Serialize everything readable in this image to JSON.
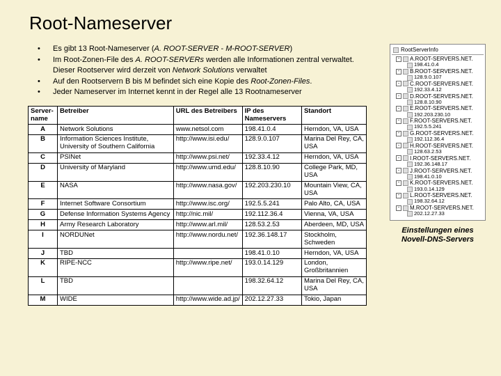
{
  "title": "Root-Nameserver",
  "bullets": [
    "Es gibt 13 Root-Nameserver  (<em>A. ROOT-SERVER</em> - <em>M-ROOT-SERVER</em>)",
    "Im Root-Zonen-File des <em>A. ROOT-SERVERs</em> werden alle Informationen zentral verwaltet. Dieser Rootserver wird derzeit von <em>Network Solutions</em> verwaltet",
    "Auf den Rootservern B bis M befindet sich eine Kopie des <em>Root-Zonen-Files</em>.",
    "Jeder Nameserver im Internet kennt in der Regel alle 13 Rootnameserver"
  ],
  "table": {
    "headers": [
      "Server-name",
      "Betreiber",
      "URL des Betreibers",
      "IP des Nameservers",
      "Standort"
    ],
    "rows": [
      [
        "A",
        "Network Solutions",
        "www.netsol.com",
        "198.41.0.4",
        "Herndon, VA, USA"
      ],
      [
        "B",
        "Information Sciences Institute, University of Southern California",
        "http://www.isi.edu/",
        "128.9.0.107",
        "Marina Del Rey, CA, USA"
      ],
      [
        "C",
        "PSINet",
        "http://www.psi.net/",
        "192.33.4.12",
        "Herndon, VA, USA"
      ],
      [
        "D",
        "University of Maryland",
        "http://www.umd.edu/",
        "128.8.10.90",
        "College Park, MD, USA"
      ],
      [
        "E",
        "NASA",
        "http://www.nasa.gov/",
        "192.203.230.10",
        "Mountain View, CA, USA"
      ],
      [
        "F",
        "Internet Software Consortium",
        "http://www.isc.org/",
        "192.5.5.241",
        "Palo Alto, CA, USA"
      ],
      [
        "G",
        "Defense Information Systems Agency",
        "http://nic.mil/",
        "192.112.36.4",
        "Vienna, VA, USA"
      ],
      [
        "H",
        "Army Research Laboratory",
        "http://www.arl.mil/",
        "128.53.2.53",
        "Aberdeen, MD, USA"
      ],
      [
        "I",
        "NORDUNet",
        "http://www.nordu.net/",
        "192.36.148.17",
        "Stockholm, Schweden"
      ],
      [
        "J",
        "TBD",
        "",
        "198.41.0.10",
        "Herndon, VA, USA"
      ],
      [
        "K",
        "RIPE-NCC",
        "http://www.ripe.net/",
        "193.0.14.129",
        "London, Großbritannien"
      ],
      [
        "L",
        "TBD",
        "",
        "198.32.64.12",
        "Marina Del Rey, CA, USA"
      ],
      [
        "M",
        "WIDE",
        "http://www.wide.ad.jp/",
        "202.12.27.33",
        "Tokio, Japan"
      ]
    ]
  },
  "screenshot": {
    "header": "RootServerInfo",
    "items": [
      {
        "name": "A.ROOT-SERVERS.NET.",
        "ip": "198.41.0.4"
      },
      {
        "name": "B.ROOT-SERVERS.NET.",
        "ip": "128.9.0.107"
      },
      {
        "name": "C.ROOT-SERVERS.NET.",
        "ip": "192.33.4.12"
      },
      {
        "name": "D.ROOT-SERVERS.NET.",
        "ip": "128.8.10.90"
      },
      {
        "name": "E.ROOT-SERVERS.NET.",
        "ip": "192.203.230.10"
      },
      {
        "name": "F.ROOT-SERVERS.NET.",
        "ip": "192.5.5.241"
      },
      {
        "name": "G.ROOT-SERVERS.NET.",
        "ip": "192.112.36.4"
      },
      {
        "name": "H.ROOT-SERVERS.NET.",
        "ip": "128.63.2.53"
      },
      {
        "name": "I.ROOT-SERVERS.NET.",
        "ip": "192.36.148.17"
      },
      {
        "name": "J.ROOT-SERVERS.NET.",
        "ip": "198.41.0.10"
      },
      {
        "name": "K.ROOT-SERVERS.NET.",
        "ip": "193.0.14.129"
      },
      {
        "name": "L.ROOT-SERVERS.NET.",
        "ip": "198.32.64.12"
      },
      {
        "name": "M.ROOT-SERVERS.NET.",
        "ip": "202.12.27.33"
      }
    ]
  },
  "caption": "Einstellungen eines Novell-DNS-Servers"
}
